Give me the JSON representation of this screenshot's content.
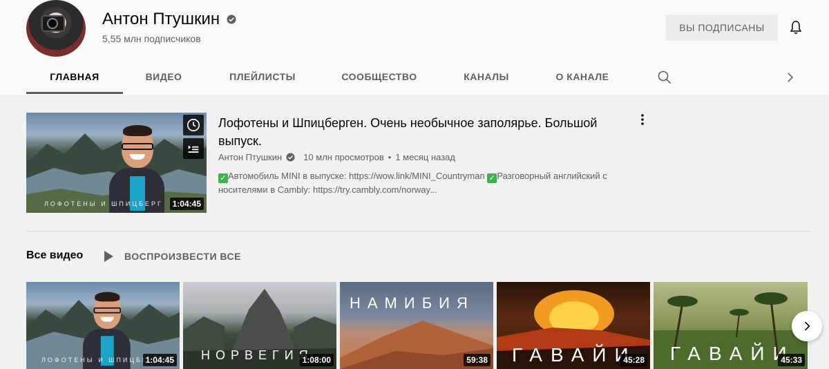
{
  "channel": {
    "name": "Антон Птушкин",
    "subscribers": "5,55 млн подписчиков",
    "subscribed_label": "ВЫ ПОДПИСАНЫ"
  },
  "tabs": [
    {
      "label": "ГЛАВНАЯ",
      "active": true
    },
    {
      "label": "ВИДЕО"
    },
    {
      "label": "ПЛЕЙЛИСТЫ"
    },
    {
      "label": "СООБЩЕСТВО"
    },
    {
      "label": "КАНАЛЫ"
    },
    {
      "label": "О КАНАЛЕ"
    }
  ],
  "featured": {
    "title": "Лофотены и Шпицберген. Очень необычное заполярье. Большой выпуск.",
    "author": "Антон Птушкин",
    "views": "10 млн просмотров",
    "separator": "•",
    "age": "1 месяц назад",
    "desc_part1": "Автомобиль MINI в выпуске: https://wow.link/MINI_Countryman",
    "desc_part2": "Разговорный английский с носителями в Cambly: https://try.cambly.com/norway...",
    "duration": "1:04:45",
    "thumb_caption": "ЛОФОТЕНЫ И ШПИЦБЕРГ"
  },
  "section": {
    "title": "Все видео",
    "play_all": "ВОСПРОИЗВЕСТИ ВСЕ"
  },
  "videos": [
    {
      "caption": "ЛОФОТЕНЫ И ШПИЦБЕ",
      "duration": "1:04:45"
    },
    {
      "caption": "НОРВЕГИЯ",
      "duration": "1:08:00"
    },
    {
      "caption": "НАМИБИЯ",
      "duration": "59:38"
    },
    {
      "caption": "ГАВАЙИ",
      "duration": "45:28"
    },
    {
      "caption": "ГАВАЙИ",
      "duration": "45:33"
    }
  ]
}
